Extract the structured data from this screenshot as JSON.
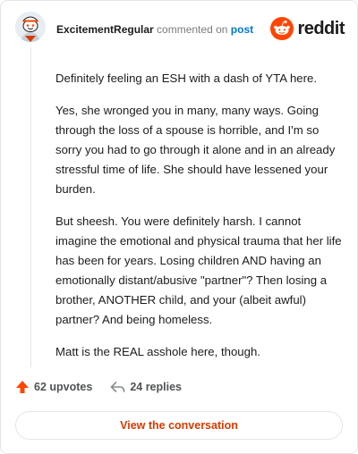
{
  "header": {
    "username": "ExcitementRegular",
    "action_text": "commented on",
    "post_link": "post",
    "brand_name": "reddit"
  },
  "comment": {
    "paragraphs": [
      "Definitely feeling an ESH with a dash of YTA here.",
      "Yes, she wronged you in many, many ways. Going through the loss of a spouse is horrible, and I'm so sorry you had to go through it alone and in an already stressful time of life. She should have lessened your burden.",
      "But sheesh. You were definitely harsh. I cannot imagine the emotional and physical trauma that her life has been for years. Losing children AND having an emotionally distant/abusive \"partner\"? Then losing a brother, ANOTHER child, and your (albeit awful) partner? And being homeless.",
      "Matt is the REAL asshole here, though."
    ]
  },
  "stats": {
    "upvotes": "62 upvotes",
    "replies": "24 replies"
  },
  "cta": {
    "label": "View the conversation"
  },
  "colors": {
    "brand": "#ff4500",
    "link": "#0079d3",
    "cta_text": "#d93a00"
  },
  "icons": {
    "avatar": "snoo-avatar-icon",
    "brand": "reddit-logo-icon",
    "upvote": "upvote-arrow-icon",
    "reply": "reply-arrow-icon"
  }
}
